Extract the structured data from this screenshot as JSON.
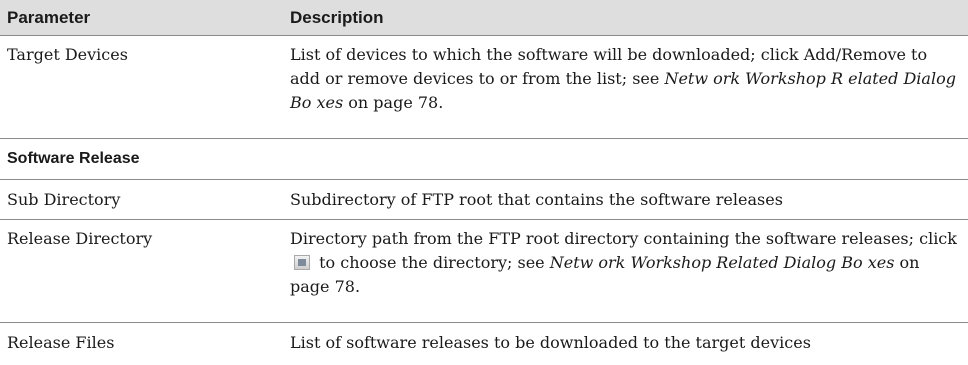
{
  "table": {
    "header": {
      "parameter": "Parameter",
      "description": "Description"
    },
    "target_devices": {
      "param": "Target Devices",
      "desc_part1": "List of devices to which the software will be downloaded; click Add/Remove to add or remove devices to or from the list; see ",
      "desc_link": "Netw ork Workshop R elated Dialog Bo xes",
      "desc_part2": " on page 78."
    },
    "section_software_release": "Software Release",
    "sub_directory": {
      "param": "Sub Directory",
      "desc": "Subdirectory of FTP root that contains the software releases"
    },
    "release_directory": {
      "param": "Release Directory",
      "desc_part1": "Directory path from the FTP root directory containing the software releases; click ",
      "icon": "browse-folder-icon",
      "desc_part2": " to choose the directory; see ",
      "desc_link": "Netw ork Workshop Related Dialog Bo xes",
      "desc_part3": " on page 78."
    },
    "release_files": {
      "param": "Release Files",
      "desc": "List of software releases to be downloaded to the target devices"
    }
  }
}
